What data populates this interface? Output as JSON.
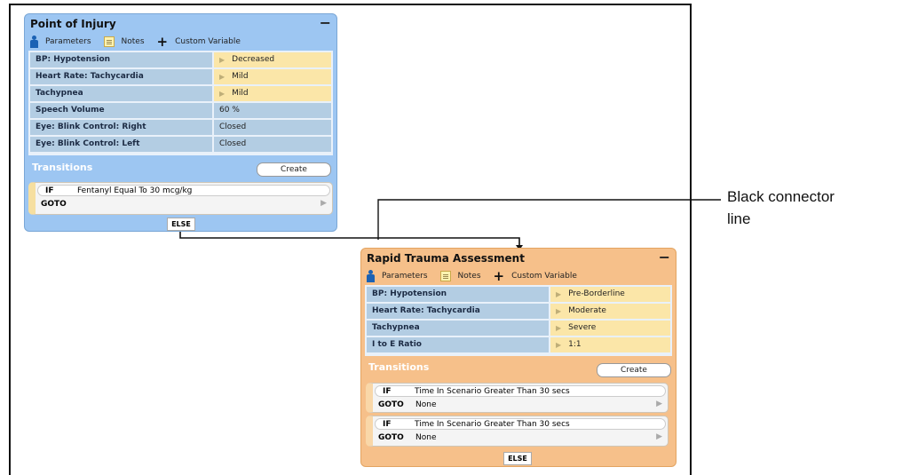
{
  "callout": {
    "line1": "Black connector",
    "line2": "line"
  },
  "node1": {
    "title": "Point of Injury",
    "collapse": "−",
    "toolbar": {
      "parameters": "Parameters",
      "notes": "Notes",
      "custom_variable": "Custom Variable"
    },
    "params": [
      {
        "name": "BP: Hypotension",
        "value": "Decreased",
        "has_arrow": true
      },
      {
        "name": "Heart Rate: Tachycardia",
        "value": "Mild",
        "has_arrow": true
      },
      {
        "name": "Tachypnea",
        "value": "Mild",
        "has_arrow": true
      },
      {
        "name": "Speech Volume",
        "value": "60 %",
        "has_arrow": false
      },
      {
        "name": "Eye: Blink Control: Right",
        "value": "Closed",
        "has_arrow": false
      },
      {
        "name": "Eye: Blink Control: Left",
        "value": "Closed",
        "has_arrow": false
      }
    ],
    "transitions_label": "Transitions",
    "create": "Create",
    "transitions": [
      {
        "if_kw": "IF",
        "condition": "Fentanyl Equal To 30 mcg/kg",
        "goto_kw": "GOTO",
        "goto": ""
      }
    ],
    "else": "ELSE"
  },
  "node2": {
    "title": "Rapid Trauma Assessment",
    "collapse": "−",
    "toolbar": {
      "parameters": "Parameters",
      "notes": "Notes",
      "custom_variable": "Custom Variable"
    },
    "params": [
      {
        "name": "BP: Hypotension",
        "value": "Pre-Borderline",
        "has_arrow": true
      },
      {
        "name": "Heart Rate: Tachycardia",
        "value": "Moderate",
        "has_arrow": true
      },
      {
        "name": "Tachypnea",
        "value": "Severe",
        "has_arrow": true
      },
      {
        "name": "I to E Ratio",
        "value": "1:1",
        "has_arrow": true
      }
    ],
    "transitions_label": "Transitions",
    "create": "Create",
    "transitions": [
      {
        "if_kw": "IF",
        "condition": "Time In Scenario Greater Than 30 secs",
        "goto_kw": "GOTO",
        "goto": "None"
      },
      {
        "if_kw": "IF",
        "condition": "Time In Scenario Greater Than 30 secs",
        "goto_kw": "GOTO",
        "goto": "None"
      }
    ],
    "else": "ELSE"
  }
}
